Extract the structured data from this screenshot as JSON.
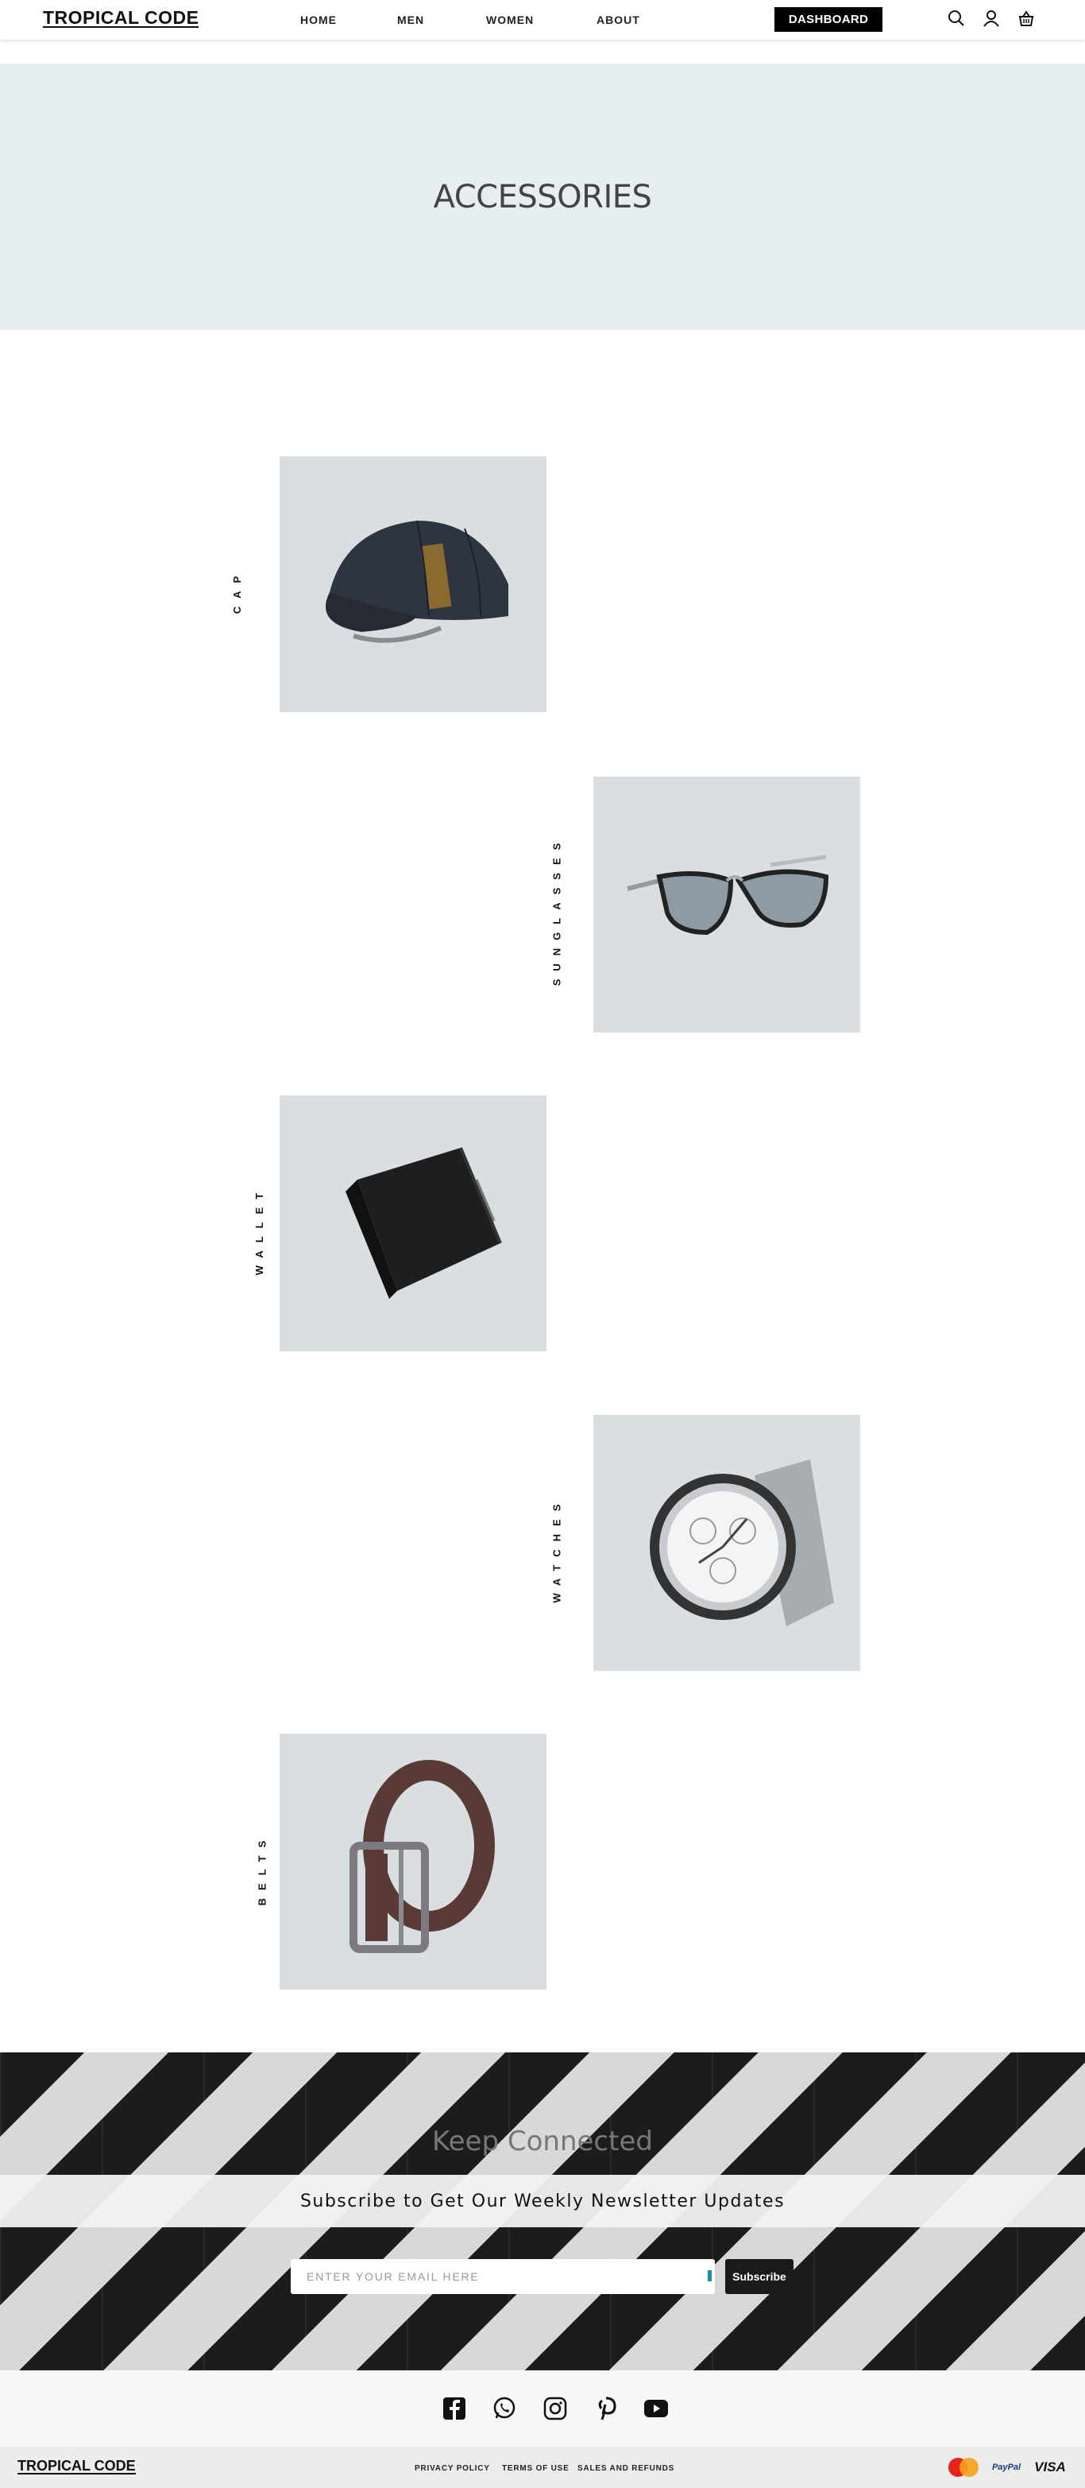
{
  "nav": {
    "logo": "TROPICAL CODE",
    "links": [
      "HOME",
      "MEN",
      "WOMEN",
      "ABOUT"
    ],
    "dashboard": "DASHBOARD",
    "icons": [
      "search-icon",
      "user-icon",
      "basket-icon"
    ]
  },
  "hero": {
    "title": "ACCESSORIES"
  },
  "categories": [
    {
      "label": "CAP",
      "image": "cap-image"
    },
    {
      "label": "SUNGLASSES",
      "image": "sunglasses-image"
    },
    {
      "label": "WALLET",
      "image": "wallet-image"
    },
    {
      "label": "WATCHES",
      "image": "watch-image"
    },
    {
      "label": "BELTS",
      "image": "belt-image"
    }
  ],
  "newsletter": {
    "title": "Keep Connected",
    "subtitle": "Subscribe to Get Our Weekly Newsletter Updates",
    "email_placeholder": "ENTER YOUR EMAIL HERE",
    "button": "Subscribe"
  },
  "social": [
    "facebook-icon",
    "whatsapp-icon",
    "instagram-icon",
    "pinterest-icon",
    "youtube-icon"
  ],
  "footer": {
    "logo": "TROPICAL CODE",
    "links": [
      "PRIVACY POLICY",
      "TERMS OF USE",
      "SALES AND REFUNDS"
    ],
    "payment": [
      "mastercard-icon",
      "paypal-icon",
      "visa-icon"
    ],
    "paypal_text": "PayPal",
    "visa_text": "VISA"
  },
  "colors": {
    "hero_bg": "#e7eef1",
    "card_bg": "#d9dee0",
    "accent": "#000000"
  }
}
